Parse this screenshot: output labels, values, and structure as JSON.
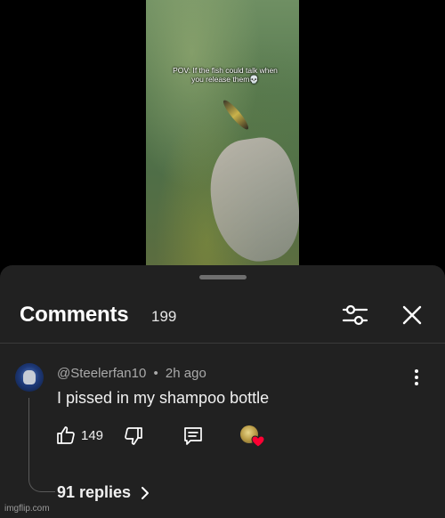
{
  "video": {
    "caption": "POV: If the fish could talk when you release them💀"
  },
  "comments_panel": {
    "title": "Comments",
    "count": "199"
  },
  "comment": {
    "author": "@Steelerfan10",
    "separator": "•",
    "time": "2h ago",
    "text": "I pissed in my shampoo bottle",
    "like_count": "149",
    "replies_label": "91 replies"
  },
  "icons": {
    "filter": "sliders-icon",
    "close": "close-icon",
    "more": "more-vertical-icon",
    "like": "thumbs-up-icon",
    "dislike": "thumbs-down-icon",
    "reply": "reply-icon",
    "heart": "heart-icon",
    "chevron": "chevron-right-icon"
  },
  "colors": {
    "sheet_bg": "#212121",
    "heart": "#ff0033",
    "secondary_text": "#aaaaaa"
  },
  "watermark": "imgflip.com"
}
